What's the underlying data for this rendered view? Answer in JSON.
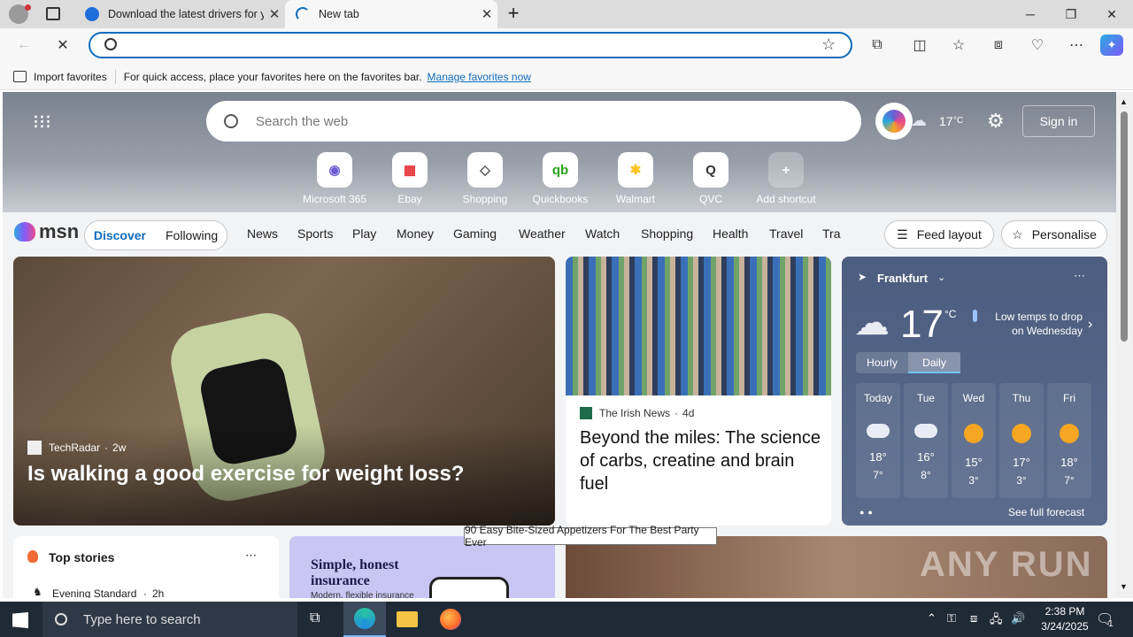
{
  "browser": {
    "tabs": [
      {
        "title": "Download the latest drivers for y"
      },
      {
        "title": "New tab"
      }
    ],
    "address": {
      "value": "",
      "placeholder": ""
    },
    "favorites_bar": {
      "import": "Import favorites",
      "hint": "For quick access, place your favorites here on the favorites bar.",
      "manage": "Manage favorites now"
    }
  },
  "newtab": {
    "search_placeholder": "Search the web",
    "weather_temp": "17",
    "weather_unit": "°C",
    "sign_in": "Sign in",
    "shortcuts": [
      {
        "label": "Microsoft 365",
        "glyph": "◉",
        "color": "#6b5cd6"
      },
      {
        "label": "Ebay",
        "glyph": "▦",
        "color": "#e53238"
      },
      {
        "label": "Shopping",
        "glyph": "◇",
        "color": "#555555"
      },
      {
        "label": "Quickbooks",
        "glyph": "qb",
        "color": "#2ca01c"
      },
      {
        "label": "Walmart",
        "glyph": "✱",
        "color": "#ffc220"
      },
      {
        "label": "QVC",
        "glyph": "Q",
        "color": "#333333"
      },
      {
        "label": "Add shortcut",
        "glyph": "+",
        "color": "#ffffff"
      }
    ]
  },
  "msn": {
    "logo": "msn",
    "tabs": {
      "discover": "Discover",
      "following": "Following"
    },
    "nav": [
      "News",
      "Sports",
      "Play",
      "Money",
      "Gaming",
      "Weather",
      "Watch",
      "Shopping",
      "Health",
      "Travel",
      "Tra"
    ],
    "feed_layout": "Feed layout",
    "personalise": "Personalise"
  },
  "lead_story": {
    "source": "TechRadar",
    "age": "2w",
    "headline": "Is walking a good exercise for weight loss?"
  },
  "story2": {
    "source": "The Irish News",
    "age": "4d",
    "headline": "Beyond the miles: The science of carbs, creatine and brain fuel"
  },
  "weather": {
    "city": "Frankfurt",
    "temp": "17",
    "unit": "°C",
    "note": "Low temps to drop on Wednesday",
    "tabs": {
      "hourly": "Hourly",
      "daily": "Daily"
    },
    "days": [
      {
        "name": "Today",
        "high": "18°",
        "low": "7°"
      },
      {
        "name": "Tue",
        "high": "16°",
        "low": "8°"
      },
      {
        "name": "Wed",
        "high": "15°",
        "low": "3°"
      },
      {
        "name": "Thu",
        "high": "17°",
        "low": "3°"
      },
      {
        "name": "Fri",
        "high": "18°",
        "low": "7°"
      }
    ],
    "see_full": "See full forecast"
  },
  "top_stories": {
    "title": "Top stories",
    "source": "Evening Standard",
    "age": "2h"
  },
  "ad": {
    "headline": "Simple, honest insurance",
    "sub": "Modern, flexible insurance"
  },
  "tooltip": "90 Easy Bite-Sized Appetizers For The Best Party Ever",
  "watermark": "ANY RUN",
  "taskbar": {
    "search_placeholder": "Type here to search",
    "time": "2:38 PM",
    "date": "3/24/2025",
    "notif_count": "1"
  }
}
